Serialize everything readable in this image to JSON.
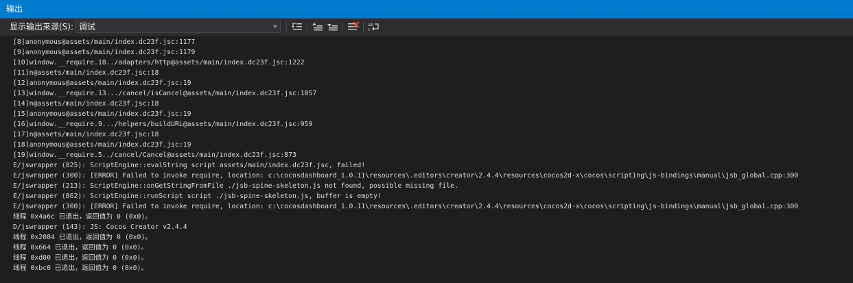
{
  "window": {
    "title": "输出"
  },
  "toolbar": {
    "source_label": "显示输出来源(S):",
    "source_value": "调试",
    "buttons": [
      {
        "icon": "go-to-location-icon"
      },
      {
        "icon": "previous-message-icon"
      },
      {
        "icon": "next-message-icon"
      },
      {
        "icon": "clear-all-icon"
      },
      {
        "icon": "toggle-word-wrap-icon"
      }
    ]
  },
  "colors": {
    "title_bar": "#007acc",
    "toolbar_bg": "#2d2d30",
    "output_bg": "#1e1e1e",
    "text": "#dcdcdc"
  },
  "output_lines": [
    "[8]anonymous@assets/main/index.dc23f.jsc:1177",
    "[9]anonymous@assets/main/index.dc23f.jsc:1179",
    "[10]window.__require.18../adapters/http@assets/main/index.dc23f.jsc:1222",
    "[11]n@assets/main/index.dc23f.jsc:18",
    "[12]anonymous@assets/main/index.dc23f.jsc:19",
    "[13]window.__require.13.../cancel/isCancel@assets/main/index.dc23f.jsc:1057",
    "[14]n@assets/main/index.dc23f.jsc:18",
    "[15]anonymous@assets/main/index.dc23f.jsc:19",
    "[16]window.__require.9.../helpers/buildURL@assets/main/index.dc23f.jsc:959",
    "[17]n@assets/main/index.dc23f.jsc:18",
    "[18]anonymous@assets/main/index.dc23f.jsc:19",
    "[19]window.__require.5../cancel/Cancel@assets/main/index.dc23f.jsc:873",
    "E/jswrapper (825): ScriptEngine::evalString script assets/main/index.dc23f.jsc, failed!",
    "E/jswrapper (300): [ERROR] Failed to invoke require, location: c:\\cocosdashboard_1.0.11\\resources\\.editors\\creator\\2.4.4\\resources\\cocos2d-x\\cocos\\scripting\\js-bindings\\manual\\jsb_global.cpp:300",
    "E/jswrapper (213): ScriptEngine::onGetStringFromFile ./jsb-spine-skeleton.js not found, possible missing file.",
    "E/jswrapper (862): ScriptEngine::runScript script ./jsb-spine-skeleton.js, buffer is empty!",
    "E/jswrapper (300): [ERROR] Failed to invoke require, location: c:\\cocosdashboard_1.0.11\\resources\\.editors\\creator\\2.4.4\\resources\\cocos2d-x\\cocos\\scripting\\js-bindings\\manual\\jsb_global.cpp:300",
    "线程 0x4a6c 已退出，返回值为 0 (0x0)。",
    "D/jswrapper (143): JS: Cocos Creator v2.4.4",
    "线程 0x2084 已退出，返回值为 0 (0x0)。",
    "线程 0x664 已退出，返回值为 0 (0x0)。",
    "线程 0xd00 已退出，返回值为 0 (0x0)。",
    "线程 0xbc0 已退出，返回值为 0 (0x0)。"
  ]
}
